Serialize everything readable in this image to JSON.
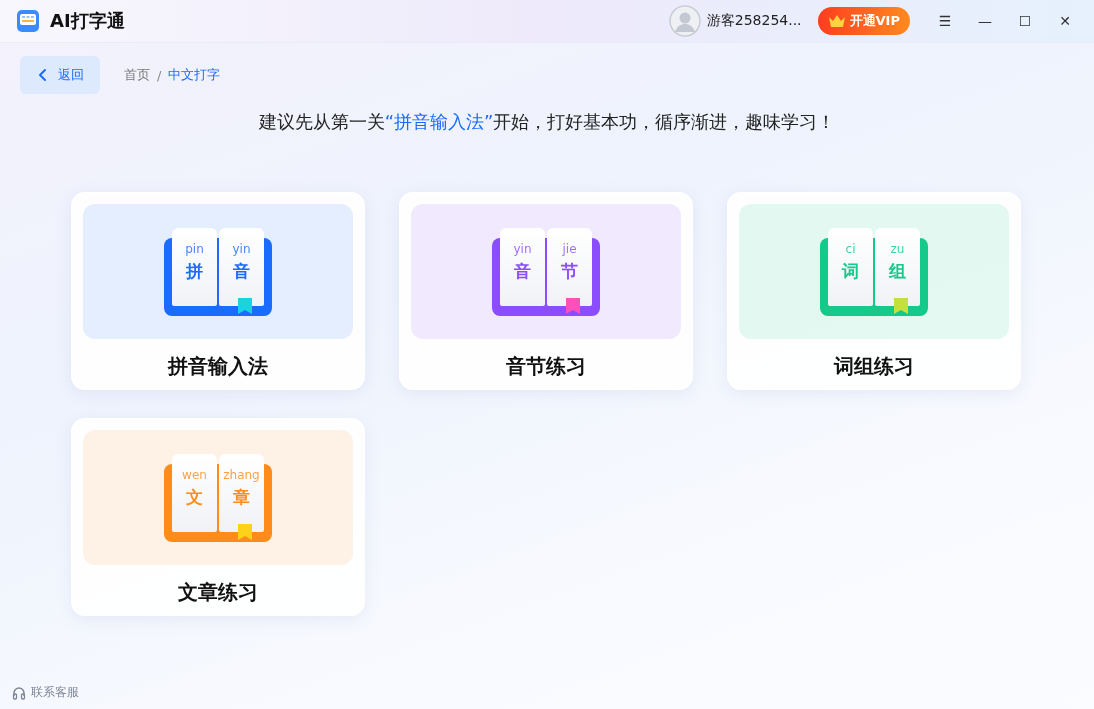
{
  "app": {
    "title": "AI打字通"
  },
  "user": {
    "name": "游客258254..."
  },
  "vip_button": {
    "label": "开通VIP"
  },
  "window_controls": [
    "☰",
    "—",
    "☐",
    "✕"
  ],
  "back_button": {
    "label": "返回"
  },
  "breadcrumb_separator": "/",
  "breadcrumb": [
    {
      "label": "首页",
      "selected": false
    },
    {
      "label": "中文打字",
      "selected": true
    }
  ],
  "tip": {
    "before": "建议先从第一关",
    "highlight": "“拼音输入法”",
    "after": "开始，打好基本功，循序渐进，趣味学习！"
  },
  "cards": [
    {
      "title": "拼音输入法",
      "color": "#1a6cff",
      "bookmark": {
        "color": "#19d3e0"
      },
      "pinyin": [
        "pin",
        "yin"
      ],
      "characters": [
        "拼",
        "音"
      ]
    },
    {
      "title": "音节练习",
      "color": "#8b4dff",
      "bookmark": {
        "color": "#ff4fb8"
      },
      "pinyin": [
        "yin",
        "jie"
      ],
      "characters": [
        "音",
        "节"
      ]
    },
    {
      "title": "词组练习",
      "color": "#14c98a",
      "bookmark": {
        "color": "#c5e03a"
      },
      "pinyin": [
        "ci",
        "zu"
      ],
      "characters": [
        "词",
        "组"
      ]
    },
    {
      "title": "文章练习",
      "color": "#ff8c1a",
      "bookmark": {
        "color": "#ffd21a"
      },
      "pinyin": [
        "wen",
        "zhang"
      ],
      "characters": [
        "文",
        "章"
      ]
    }
  ],
  "support": {
    "label": "联系客服"
  }
}
